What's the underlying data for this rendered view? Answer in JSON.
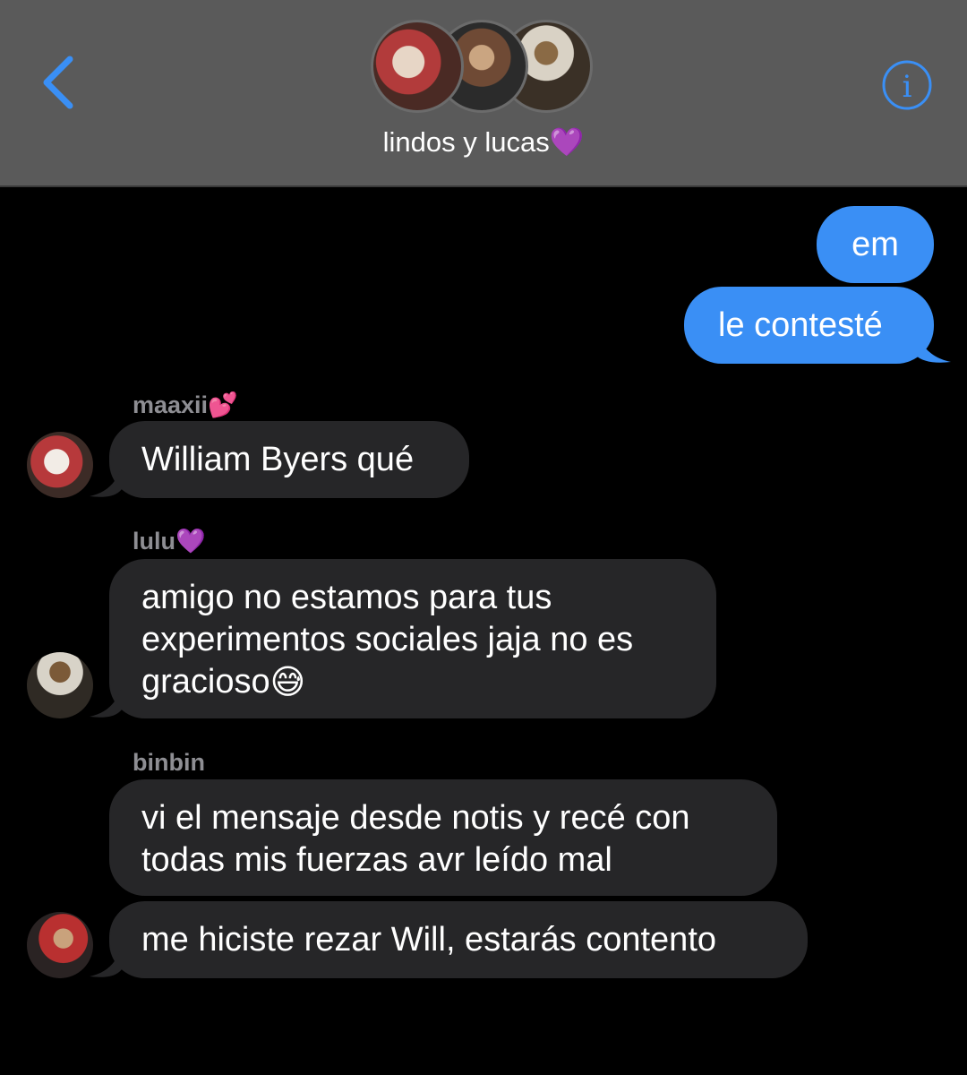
{
  "header": {
    "group_name": "lindos y lucas💜",
    "back_icon": "chevron-left-icon",
    "info_icon": "info-circle-icon",
    "accent_color": "#3a8ff5"
  },
  "messages": {
    "outgoing": [
      {
        "text": "em"
      },
      {
        "text": "le contesté"
      }
    ],
    "maaxii": {
      "sender": "maaxii💕",
      "text": "William Byers qué"
    },
    "lulu": {
      "sender": "lulu💜",
      "lines": [
        "amigo no estamos para tus",
        "experimentos sociales jaja no es",
        "gracioso"
      ],
      "emoji": "😅"
    },
    "binbin": {
      "sender": "binbin",
      "msg1_lines": [
        "vi el mensaje desde notis y recé con",
        "todas mis fuerzas avr leído mal"
      ],
      "msg2": "me hiciste rezar Will, estarás contento"
    }
  }
}
